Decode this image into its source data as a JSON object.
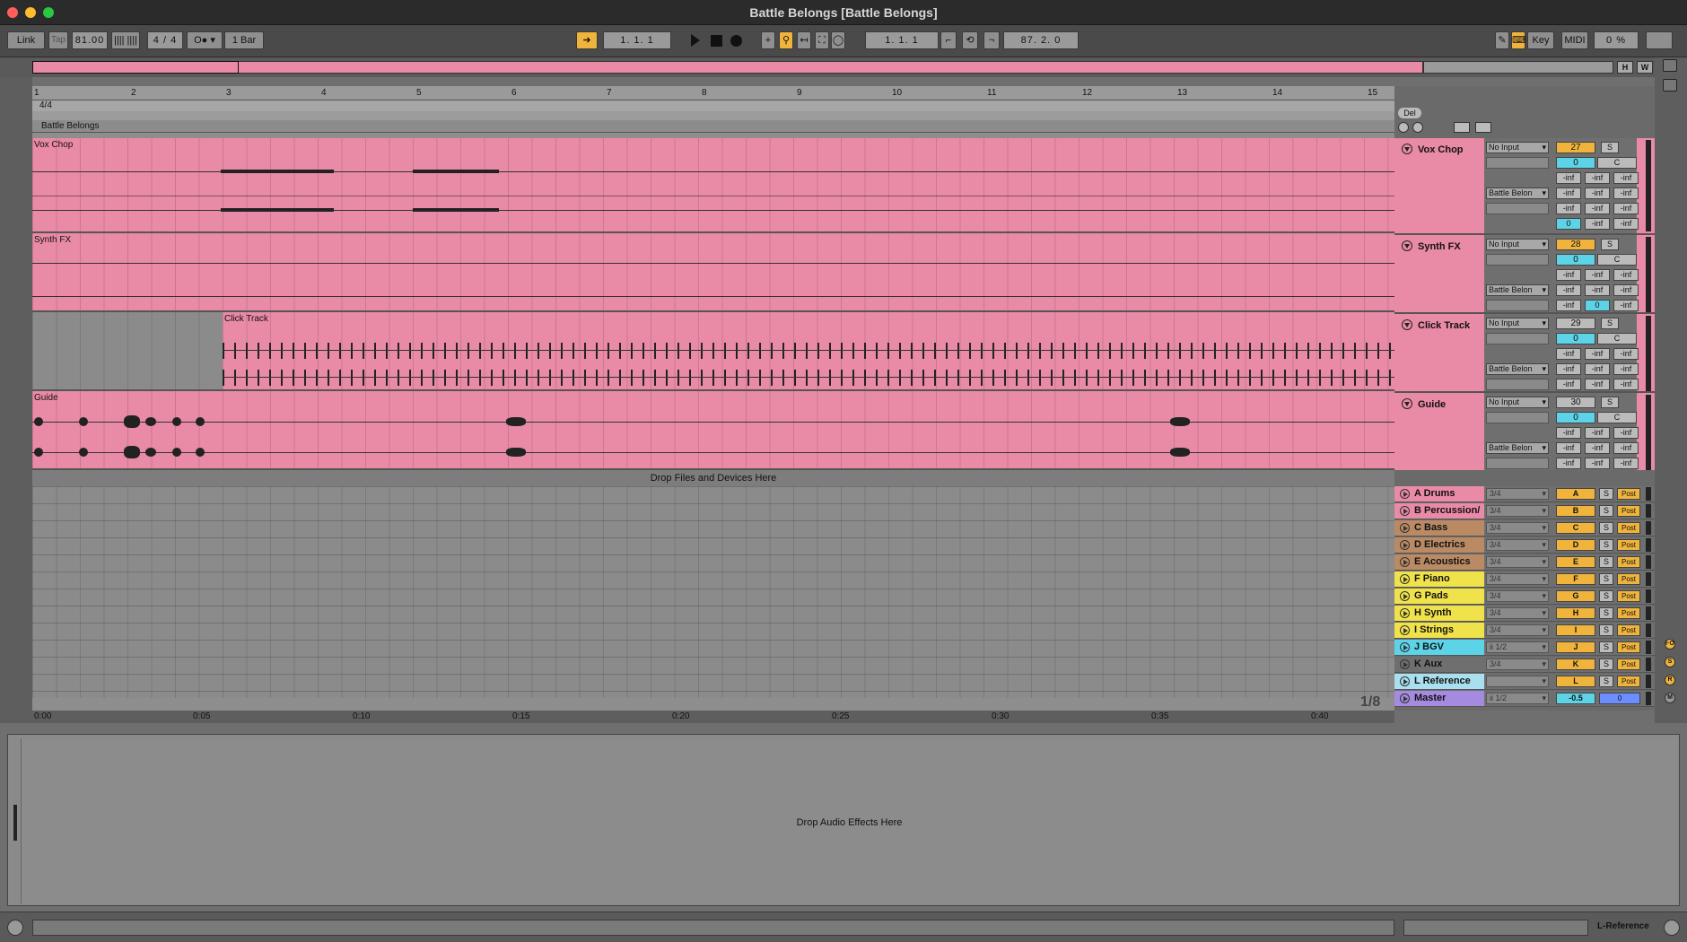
{
  "window": {
    "title": "Battle Belongs  [Battle Belongs]"
  },
  "control": {
    "link": "Link",
    "tap": "Tap",
    "tempo": "81.00",
    "sig": "4 / 4",
    "quant": "1 Bar",
    "pos": "1.   1.   1",
    "loop_start": "1.   1.   1",
    "loop_len": "87.   2.   0",
    "key": "Key",
    "midi": "MIDI",
    "cpu": "0 %"
  },
  "overview": {
    "h": "H",
    "w": "W"
  },
  "ruler": {
    "bars": [
      "1",
      "2",
      "3",
      "4",
      "5",
      "6",
      "7",
      "8",
      "9",
      "10",
      "11",
      "12",
      "13",
      "14",
      "15"
    ]
  },
  "signature": "4/4",
  "song_locator": "Battle Belongs",
  "drop_files": "Drop Files and Devices Here",
  "drop_effects": "Drop Audio Effects Here",
  "times": [
    "0:00",
    "0:05",
    "0:10",
    "0:15",
    "0:20",
    "0:25",
    "0:30",
    "0:35",
    "0:40"
  ],
  "page_zoom": "1/8",
  "del_label": "Del",
  "tracks": [
    {
      "name": "Vox Chop",
      "clip": "Vox Chop",
      "input": "No Input",
      "output": "Battle Belon",
      "num": "27",
      "solo": "S",
      "vol": "0",
      "pan": "C",
      "inf": "-inf",
      "send": "0"
    },
    {
      "name": "Synth FX",
      "clip": "Synth FX",
      "input": "No Input",
      "output": "Battle Belon",
      "num": "28",
      "solo": "S",
      "vol": "0",
      "pan": "C",
      "inf": "-inf",
      "send": "0"
    },
    {
      "name": "Click Track",
      "clip": "Click Track",
      "input": "No Input",
      "output": "Battle Belon",
      "num": "29",
      "solo": "S",
      "vol": "0",
      "pan": "C",
      "inf": "-inf"
    },
    {
      "name": "Guide",
      "clip": "Guide",
      "input": "No Input",
      "output": "Battle Belon",
      "num": "30",
      "solo": "S",
      "vol": "0",
      "pan": "C",
      "inf": "-inf"
    }
  ],
  "returns": [
    {
      "name": "A Drums",
      "sel": "3/4",
      "letter": "A",
      "color": "#e98aa6"
    },
    {
      "name": "B Percussion/",
      "sel": "3/4",
      "letter": "B",
      "color": "#e98aa6"
    },
    {
      "name": "C Bass",
      "sel": "3/4",
      "letter": "C",
      "color": "#b98a63"
    },
    {
      "name": "D Electrics",
      "sel": "3/4",
      "letter": "D",
      "color": "#b98a63"
    },
    {
      "name": "E Acoustics",
      "sel": "3/4",
      "letter": "E",
      "color": "#b98a63"
    },
    {
      "name": "F Piano",
      "sel": "3/4",
      "letter": "F",
      "color": "#f0e24a"
    },
    {
      "name": "G Pads",
      "sel": "3/4",
      "letter": "G",
      "color": "#f0e24a"
    },
    {
      "name": "H Synth",
      "sel": "3/4",
      "letter": "H",
      "color": "#f0e24a"
    },
    {
      "name": "I Strings",
      "sel": "3/4",
      "letter": "I",
      "color": "#f0e24a"
    },
    {
      "name": "J BGV",
      "sel": "ii 1/2",
      "letter": "J",
      "color": "#5cd3e6"
    },
    {
      "name": "K Aux",
      "sel": "3/4",
      "letter": "K",
      "color": "#6f6f6f"
    },
    {
      "name": "L Reference",
      "sel": "",
      "letter": "L",
      "color": "#a9dfee"
    },
    {
      "name": "Master",
      "sel": "ii 1/2",
      "letter": "-0.5",
      "color": "#a58be0"
    }
  ],
  "master": {
    "vol": "-0.5",
    "pan": "0"
  },
  "post": "Post",
  "status_label": "L-Reference"
}
